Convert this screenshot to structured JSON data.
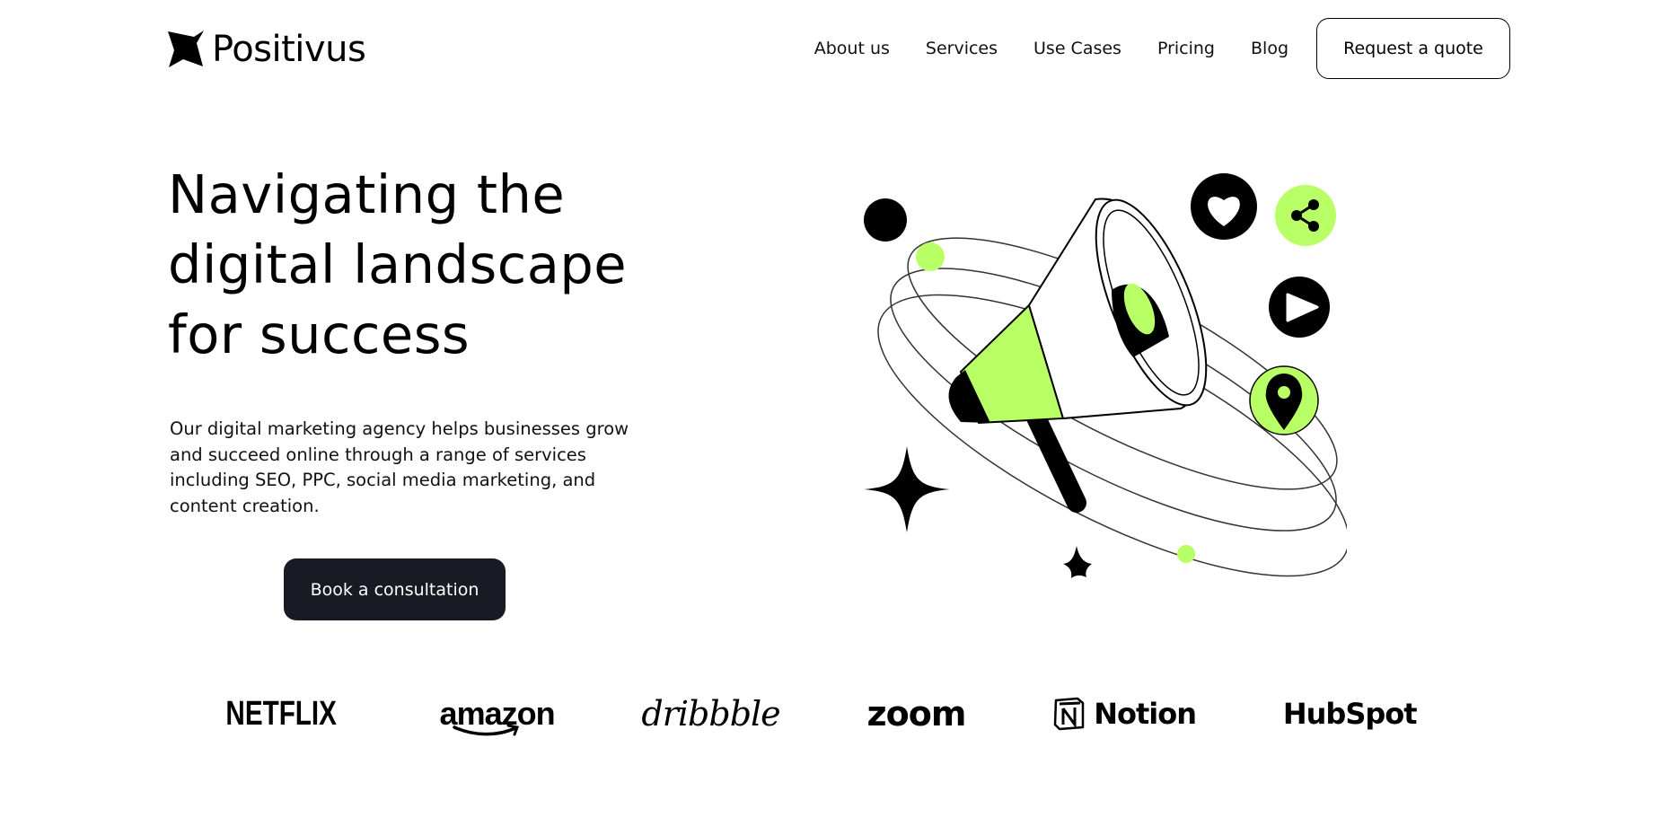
{
  "header": {
    "logo_text": "Positivus",
    "nav": [
      "About us",
      "Services",
      "Use Cases",
      "Pricing",
      "Blog"
    ],
    "cta_label": "Request a quote"
  },
  "hero": {
    "title": "Navigating the digital landscape for success",
    "description": "Our digital marketing agency helps businesses grow and succeed online through a range of services including SEO, PPC, social media marketing, and content creation.",
    "cta_label": "Book a consultation"
  },
  "brands": [
    "NETFLIX",
    "amazon",
    "dribbble",
    "zoom",
    "Notion",
    "HubSpot"
  ],
  "colors": {
    "accent": "#b9ff66",
    "dark": "#191a23",
    "background": "#ffffff"
  },
  "icons": [
    "star-logo-icon",
    "heart-icon",
    "share-icon",
    "play-icon",
    "location-pin-icon",
    "megaphone-illustration"
  ]
}
